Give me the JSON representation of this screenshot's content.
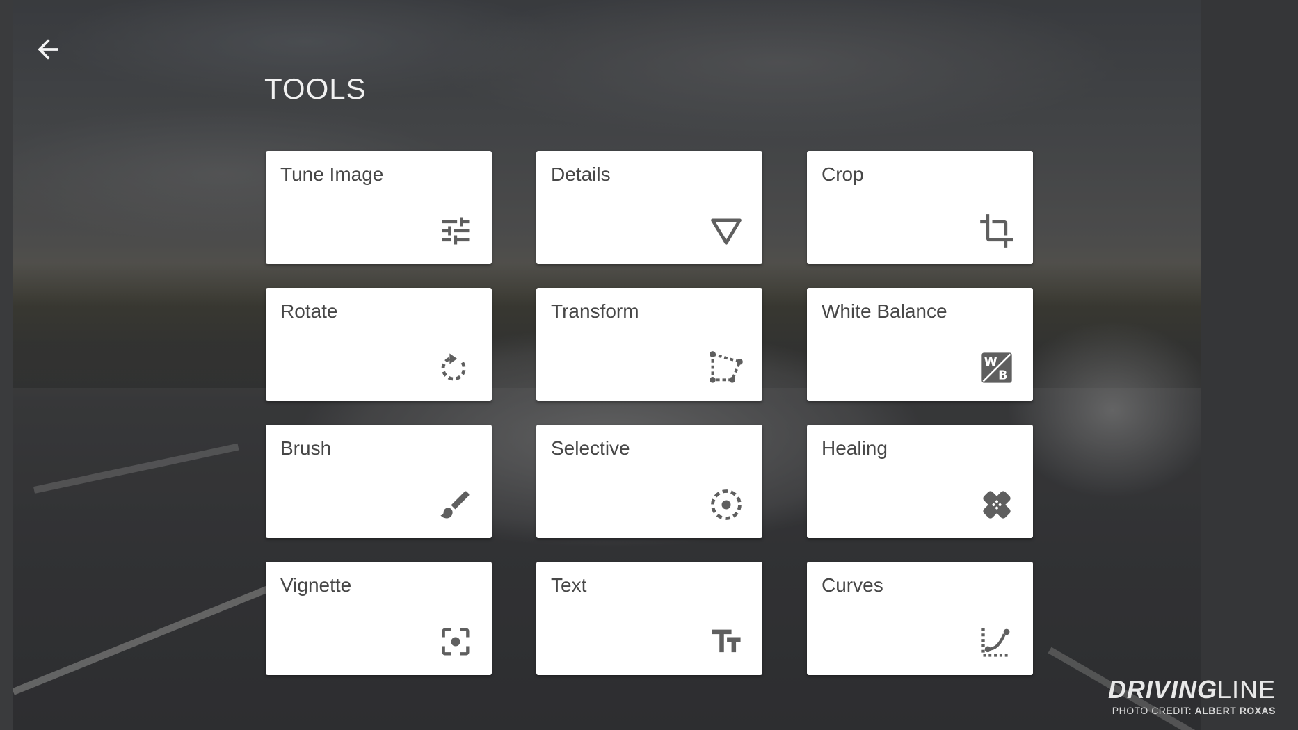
{
  "header": {
    "back_icon": "arrow-back-icon",
    "title": "TOOLS"
  },
  "tools": [
    {
      "label": "Tune Image",
      "icon": "sliders-icon"
    },
    {
      "label": "Details",
      "icon": "triangle-down-icon"
    },
    {
      "label": "Crop",
      "icon": "crop-icon"
    },
    {
      "label": "Rotate",
      "icon": "rotate-icon"
    },
    {
      "label": "Transform",
      "icon": "perspective-icon"
    },
    {
      "label": "White Balance",
      "icon": "white-balance-icon"
    },
    {
      "label": "Brush",
      "icon": "brush-icon"
    },
    {
      "label": "Selective",
      "icon": "selective-target-icon"
    },
    {
      "label": "Healing",
      "icon": "bandage-icon"
    },
    {
      "label": "Vignette",
      "icon": "vignette-focus-icon"
    },
    {
      "label": "Text",
      "icon": "text-size-icon"
    },
    {
      "label": "Curves",
      "icon": "curves-icon"
    }
  ],
  "watermark": {
    "brand_bold": "DRIVING",
    "brand_light": "LINE",
    "credit_prefix": "PHOTO CREDIT:",
    "credit_name": "ALBERT ROXAS"
  },
  "colors": {
    "card_bg": "#ffffff",
    "card_text": "#474747",
    "icon": "#5f5f5f",
    "title": "#f1f1f1"
  }
}
